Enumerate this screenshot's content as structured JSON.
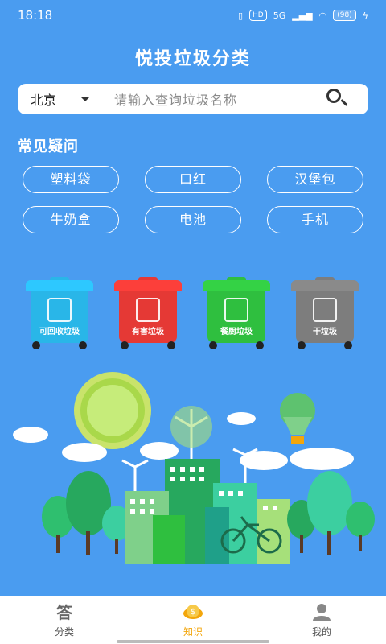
{
  "status_bar": {
    "time": "18:18",
    "hd": "HD",
    "network": "5G",
    "battery": "(98)"
  },
  "header": {
    "title": "悦投垃圾分类"
  },
  "search": {
    "city": "北京",
    "placeholder": "请输入查询垃圾名称"
  },
  "faq": {
    "title": "常见疑问",
    "items": [
      "塑料袋",
      "口红",
      "汉堡包",
      "牛奶盒",
      "电池",
      "手机"
    ]
  },
  "bins": [
    {
      "label": "可回收垃圾",
      "color": "#29b6e8"
    },
    {
      "label": "有害垃圾",
      "color": "#e53935"
    },
    {
      "label": "餐厨垃圾",
      "color": "#2fbf3f"
    },
    {
      "label": "干垃圾",
      "color": "#7d7d7d"
    }
  ],
  "tabs": [
    {
      "label": "分类",
      "icon": "answer-icon",
      "active": false
    },
    {
      "label": "知识",
      "icon": "coin-icon",
      "active": true
    },
    {
      "label": "我的",
      "icon": "user-icon",
      "active": false
    }
  ],
  "colors": {
    "background": "#4a9cf0",
    "active_tab": "#f3a60b"
  }
}
